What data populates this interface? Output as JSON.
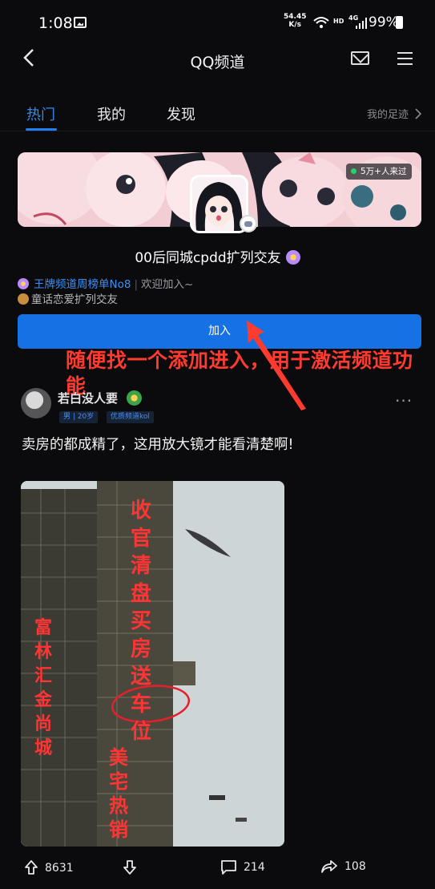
{
  "status_bar": {
    "time": "1:08",
    "net_speed_value": "54.45",
    "net_speed_unit": "K/s",
    "hd": "HD",
    "network": "4G",
    "battery": "99%"
  },
  "nav": {
    "title": "QQ频道"
  },
  "tabs": {
    "items": [
      "热门",
      "我的",
      "发现"
    ],
    "active_index": 0,
    "footprint": "我的足迹"
  },
  "channel": {
    "visitors": "5万+人来过",
    "name": "00后同城cpdd扩列交友",
    "rank": "王牌频道周榜单No8",
    "welcome": "欢迎加入~",
    "description": "童话恋爱扩列交友",
    "join_label": "加入"
  },
  "annotation": {
    "text": "随便找一个添加进入，用于激活频道功能",
    "color": "#ff3b2f"
  },
  "post": {
    "author": "若白没人要",
    "tags": [
      "男 | 20岁",
      "优质频道kol"
    ],
    "more": "···",
    "text": "卖房的都成精了，这用放大镜才能看清楚啊!",
    "image_signs": {
      "left": [
        "富",
        "林",
        "汇",
        "金",
        "尚",
        "城"
      ],
      "right": [
        "收",
        "官",
        "清",
        "盘",
        "买",
        "房",
        "送",
        "车",
        "位"
      ],
      "bottom": [
        "美",
        "宅",
        "热",
        "销"
      ]
    },
    "upvotes": "8631",
    "comments": "214",
    "shares": "108"
  },
  "colors": {
    "background": "#0b0b0d",
    "accent": "#1672e4",
    "tab_active": "#2f8cf0"
  }
}
